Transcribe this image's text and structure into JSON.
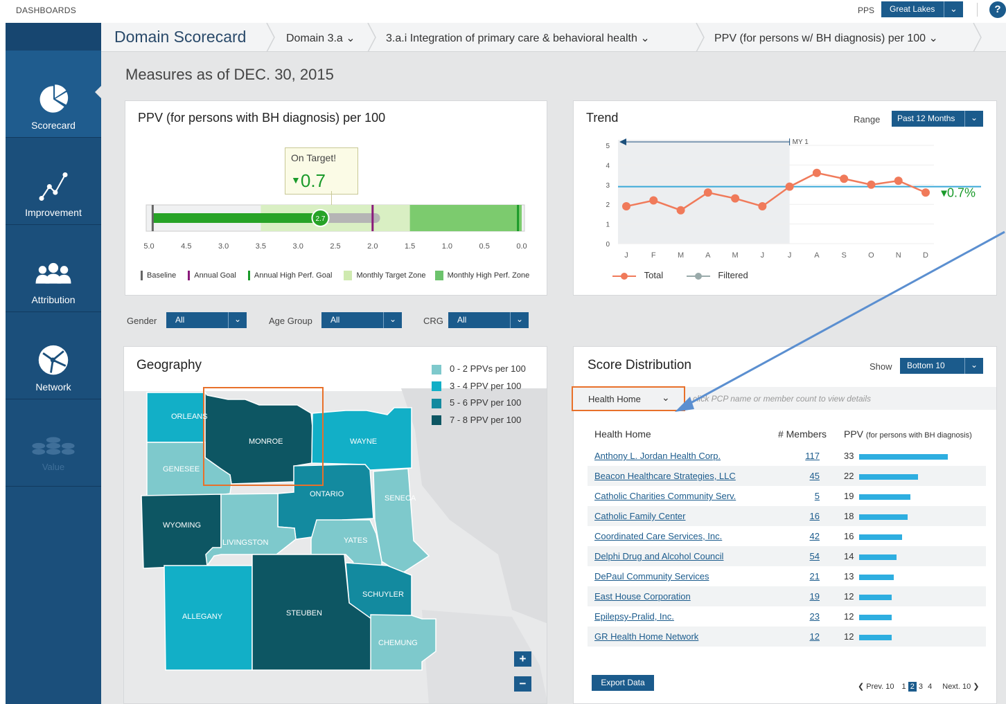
{
  "topbar": {
    "dashboards": "DASHBOARDS",
    "pps_label": "PPS",
    "pps_value": "Great Lakes",
    "help": "?"
  },
  "nav": [
    {
      "label": "Scorecard"
    },
    {
      "label": "Improvement"
    },
    {
      "label": "Attribution"
    },
    {
      "label": "Network"
    },
    {
      "label": "Value"
    }
  ],
  "breadcrumb": {
    "title": "Domain Scorecard",
    "domain": "Domain 3.a",
    "project": "3.a.i Integration of primary care & behavioral health",
    "measure": "PPV (for persons w/ BH diagnosis) per 100"
  },
  "as_of": "Measures as of DEC. 30, 2015",
  "measure_card": {
    "title": "PPV (for persons with BH diagnosis) per 100",
    "status_label": "On Target!",
    "status_value": "0.7",
    "current_value": "2.7",
    "current_numeric": 2.7,
    "baseline_numeric": 4.95,
    "annual_goal_numeric": 2.0,
    "high_perf_numeric": 0.05,
    "scale_ticks": [
      "5.0",
      "4.5",
      "3.0",
      "3.5",
      "3.0",
      "2.5",
      "2.0",
      "1.5",
      "1.0",
      "0.5",
      "0.0"
    ],
    "legend": [
      "Baseline",
      "Annual Goal",
      "Annual High Perf. Goal",
      "Monthly Target Zone",
      "Monthly High Perf. Zone"
    ]
  },
  "trend": {
    "title": "Trend",
    "range_label": "Range",
    "range_value": "Past 12 Months",
    "period_label": "MY 1",
    "change": "0.7%",
    "legend_total": "Total",
    "legend_filtered": "Filtered",
    "chart_data": {
      "type": "line",
      "categories": [
        "J",
        "F",
        "M",
        "A",
        "M",
        "J",
        "J",
        "A",
        "S",
        "O",
        "N",
        "D"
      ],
      "series": [
        {
          "name": "Total",
          "values": [
            1.9,
            2.2,
            1.7,
            2.6,
            2.3,
            1.9,
            2.9,
            3.6,
            3.3,
            3.0,
            3.2,
            2.6
          ]
        }
      ],
      "target": 2.9,
      "yticks": [
        0,
        1,
        2,
        3,
        4,
        5
      ],
      "ylim": [
        0,
        5
      ]
    }
  },
  "filters": {
    "gender_label": "Gender",
    "gender_value": "All",
    "age_label": "Age Group",
    "age_value": "All",
    "crg_label": "CRG",
    "crg_value": "All"
  },
  "geography": {
    "title": "Geography",
    "legend": [
      {
        "label": "0 - 2 PPVs per 100",
        "color": "#7ec9cc"
      },
      {
        "label": "3 - 4 PPV per 100",
        "color": "#12afc7"
      },
      {
        "label": "5 - 6 PPV per 100",
        "color": "#138a9f"
      },
      {
        "label": "7 - 8 PPV per 100",
        "color": "#0d5663"
      }
    ],
    "counties": [
      "ORLEANS",
      "MONROE",
      "WAYNE",
      "GENESEE",
      "ONTARIO",
      "SENECA",
      "WYOMING",
      "LIVINGSTON",
      "YATES",
      "SCHUYLER",
      "ALLEGANY",
      "STEUBEN",
      "CHEMUNG"
    ],
    "zoom_in": "+",
    "zoom_out": "−"
  },
  "score_dist": {
    "title": "Score Distribution",
    "show_label": "Show",
    "show_value": "Bottom 10",
    "group_value": "Health Home",
    "hint": "click PCP name or member count to view details",
    "col_name": "Health Home",
    "col_members": "# Members",
    "col_ppv": "PPV",
    "col_ppv_sub": "(for persons with BH diagnosis)",
    "rows": [
      {
        "name": "Anthony L. Jordan Health Corp.",
        "members": "117",
        "ppv": "33",
        "ppv_num": 33
      },
      {
        "name": "Beacon Healthcare Strategies, LLC",
        "members": "45",
        "ppv": "22",
        "ppv_num": 22
      },
      {
        "name": "Catholic Charities Community Serv.",
        "members": "5",
        "ppv": "19",
        "ppv_num": 19
      },
      {
        "name": "Catholic Family Center",
        "members": "16",
        "ppv": "18",
        "ppv_num": 18
      },
      {
        "name": "Coordinated Care Services, Inc.",
        "members": "42",
        "ppv": "16",
        "ppv_num": 16
      },
      {
        "name": "Delphi Drug and Alcohol Council",
        "members": "54",
        "ppv": "14",
        "ppv_num": 14
      },
      {
        "name": "DePaul Community Services",
        "members": "21",
        "ppv": "13",
        "ppv_num": 13
      },
      {
        "name": "East House Corporation",
        "members": "19",
        "ppv": "12",
        "ppv_num": 12
      },
      {
        "name": "Epilepsy-Pralid, Inc.",
        "members": "23",
        "ppv": "12",
        "ppv_num": 12
      },
      {
        "name": "GR Health Home Network",
        "members": "12",
        "ppv": "12",
        "ppv_num": 12
      }
    ],
    "export": "Export Data",
    "pager": {
      "prev": "Prev. 10",
      "pages": [
        "1",
        "2",
        "3",
        "4"
      ],
      "current": "2",
      "next": "Next. 10"
    }
  }
}
